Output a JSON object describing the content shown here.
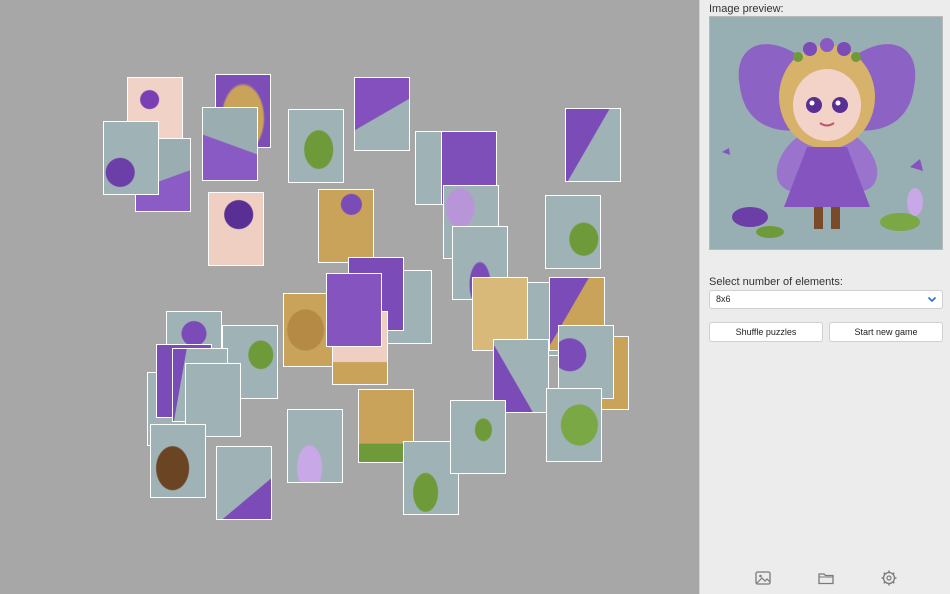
{
  "preview": {
    "label": "Image preview:"
  },
  "elements": {
    "label": "Select number of elements:",
    "value": "8x6"
  },
  "actions": {
    "shuffle_label": "Shuffle puzzles",
    "new_game_label": "Start new game"
  },
  "footer": {
    "icons": [
      "image-icon",
      "folder-icon",
      "gear-icon"
    ]
  },
  "colors": {
    "board": "#a7a7a7",
    "panel": "#ececec",
    "piece_bg": "#9fb3b7",
    "purple": "#7b4bb8",
    "green": "#6f9a3a",
    "hair": "#c9a35a",
    "skin": "#f3d3c8"
  }
}
